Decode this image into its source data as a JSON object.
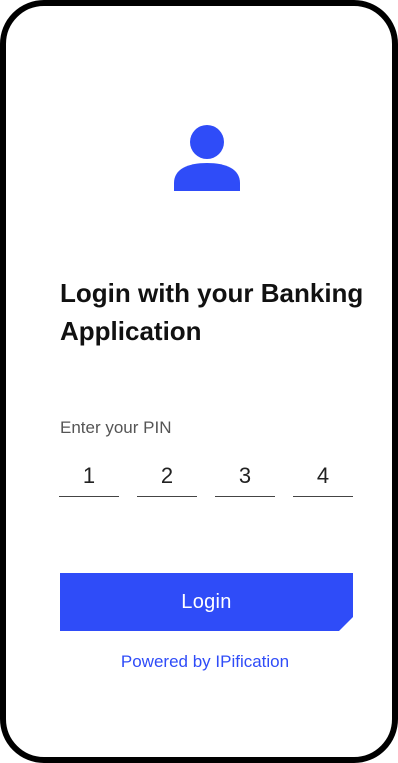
{
  "title": "Login with your Banking Application",
  "pin": {
    "label": "Enter your PIN",
    "digits": [
      "1",
      "2",
      "3",
      "4"
    ]
  },
  "login_button_label": "Login",
  "powered_by": "Powered by IPification",
  "colors": {
    "accent": "#2f4cf8",
    "frame": "#000000"
  },
  "icons": {
    "avatar": "user-icon"
  }
}
